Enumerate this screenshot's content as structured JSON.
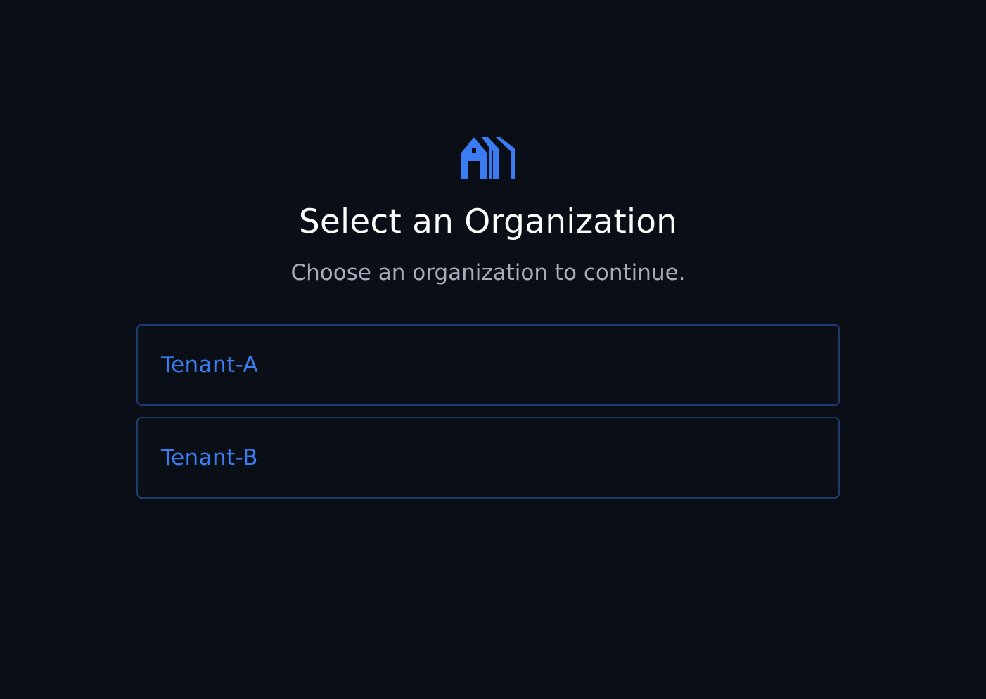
{
  "logo": {
    "icon": "building-logo-icon",
    "color": "#3b7cf2"
  },
  "header": {
    "title": "Select an Organization",
    "subtitle": "Choose an organization to continue."
  },
  "organizations": [
    {
      "label": "Tenant-A"
    },
    {
      "label": "Tenant-B"
    }
  ],
  "colors": {
    "background": "#0a0f17",
    "accent": "#3c7cf0",
    "border": "#1f3a6b",
    "title": "#ffffff",
    "subtitle": "#a7adb6"
  }
}
